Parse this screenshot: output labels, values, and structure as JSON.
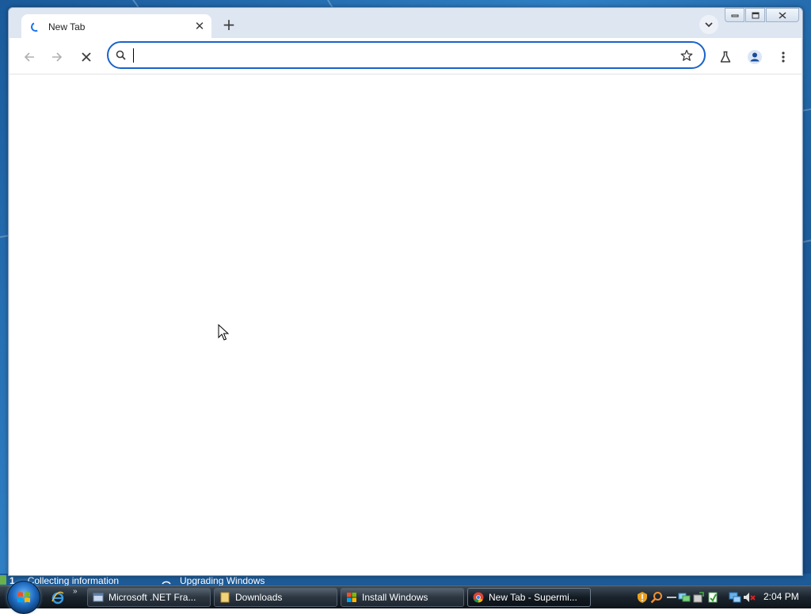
{
  "browser": {
    "tab": {
      "title": "New Tab",
      "close_label": "✕"
    },
    "new_tab_label": "+",
    "omnibox": {
      "value": "",
      "placeholder": ""
    }
  },
  "setup_status": {
    "step1_number": "1",
    "step1_label": "Collecting information",
    "step2_label": "Upgrading Windows"
  },
  "taskbar": {
    "ql_more_label": "»",
    "tasks": [
      {
        "label": "Microsoft .NET Fra..."
      },
      {
        "label": "Downloads"
      },
      {
        "label": "Install Windows"
      },
      {
        "label": "New Tab - Supermi..."
      }
    ],
    "clock": "2:04 PM"
  },
  "colors": {
    "accent": "#1a63c9",
    "titlebar": "#dee6f2",
    "taskbar": "#1a232c"
  }
}
